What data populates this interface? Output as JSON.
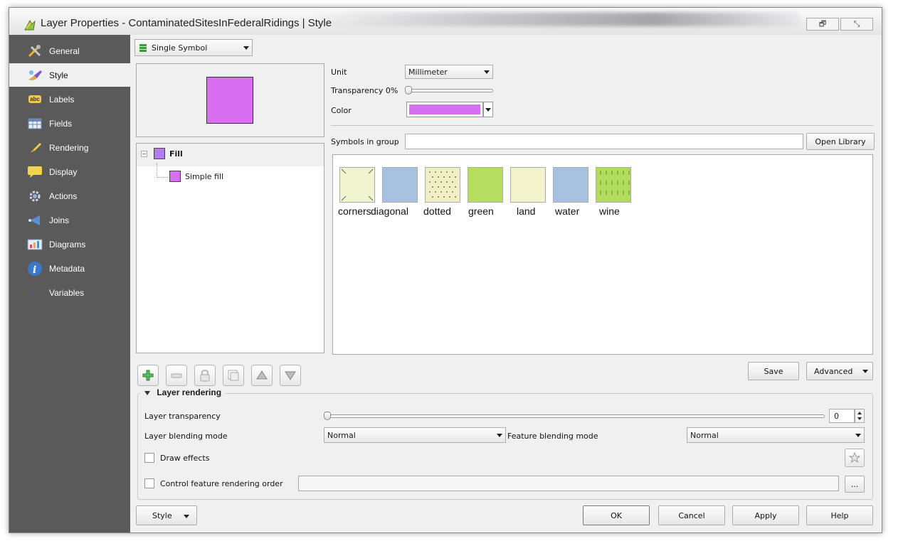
{
  "window": {
    "title": "Layer Properties - ContaminatedSitesInFederalRidings | Style",
    "controls": [
      "🗗",
      "⤡"
    ]
  },
  "sidebar": {
    "items": [
      {
        "label": "General",
        "icon": "tools-icon"
      },
      {
        "label": "Style",
        "icon": "paintbrush-icon",
        "active": true
      },
      {
        "label": "Labels",
        "icon": "abc-label-icon"
      },
      {
        "label": "Fields",
        "icon": "table-fields-icon"
      },
      {
        "label": "Rendering",
        "icon": "rendering-brush-icon"
      },
      {
        "label": "Display",
        "icon": "speech-bubble-icon"
      },
      {
        "label": "Actions",
        "icon": "gear-actions-icon"
      },
      {
        "label": "Joins",
        "icon": "joins-icon"
      },
      {
        "label": "Diagrams",
        "icon": "diagram-icon"
      },
      {
        "label": "Metadata",
        "icon": "info-icon"
      },
      {
        "label": "Variables",
        "icon": "variables-icon"
      }
    ]
  },
  "renderer": {
    "selected": "Single Symbol"
  },
  "preview": {
    "color": "#d86ff2"
  },
  "symbol_tree": {
    "root": "Fill",
    "child": "Simple fill",
    "fill_color": "#b57cf0",
    "child_color": "#d86ff2"
  },
  "properties": {
    "unit_label": "Unit",
    "unit_value": "Millimeter",
    "transparency_label": "Transparency 0%",
    "transparency_value": 0,
    "color_label": "Color",
    "color_value": "#d86ff2"
  },
  "symbols": {
    "group_label": "Symbols in group",
    "group_value": "",
    "open_library": "Open Library",
    "items": [
      {
        "label": "corners",
        "color": "#f1f5cf"
      },
      {
        "label": "diagonal",
        "color": "#a7c1df"
      },
      {
        "label": "dotted",
        "color": "#f0eec4"
      },
      {
        "label": "green",
        "color": "#b6dc60"
      },
      {
        "label": "land",
        "color": "#f3f4cd"
      },
      {
        "label": "water",
        "color": "#a7c1df"
      },
      {
        "label": "wine",
        "color": "#b2dc5c"
      }
    ]
  },
  "symbol_actions": {
    "save": "Save",
    "advanced": "Advanced"
  },
  "layer_rendering": {
    "title": "Layer rendering",
    "transparency_label": "Layer transparency",
    "transparency_value": "0",
    "blending_label": "Layer blending mode",
    "blending_value": "Normal",
    "feature_blending_label": "Feature blending mode",
    "feature_blending_value": "Normal",
    "draw_effects": "Draw effects",
    "control_order": "Control feature rendering order",
    "ellipsis": "..."
  },
  "footer": {
    "style": "Style",
    "ok": "OK",
    "cancel": "Cancel",
    "apply": "Apply",
    "help": "Help"
  }
}
